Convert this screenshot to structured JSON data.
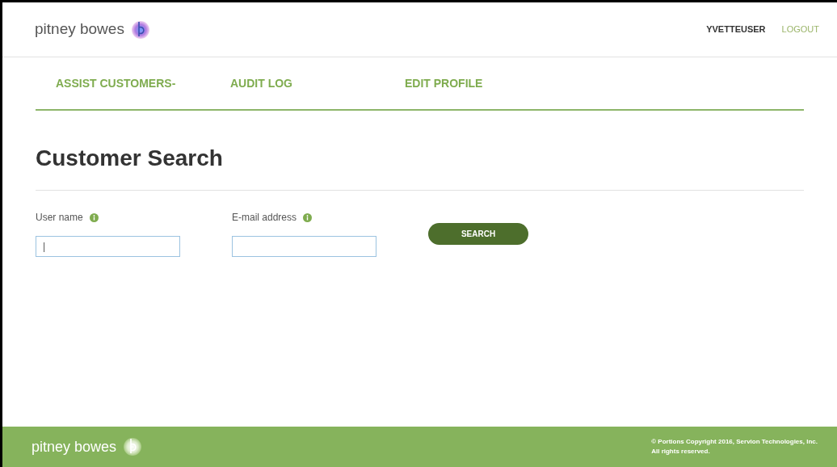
{
  "header": {
    "logo_text": "pitney bowes",
    "user": "YVETTEUSER",
    "logout": "LOGOUT"
  },
  "nav": [
    {
      "label": "ASSIST CUSTOMERS-"
    },
    {
      "label": "AUDIT LOG"
    },
    {
      "label": "EDIT PROFILE"
    }
  ],
  "page_title": "Customer Search",
  "fields": [
    {
      "label": "User name",
      "value": "|"
    },
    {
      "label": "E-mail address"
    }
  ],
  "search_button": "SEARCH",
  "footer": {
    "logo_text": "pitney bowes",
    "copyright": [
      "© Portions Copyright 2016, Servion Technologies, Inc.",
      "All rights reserved."
    ]
  }
}
